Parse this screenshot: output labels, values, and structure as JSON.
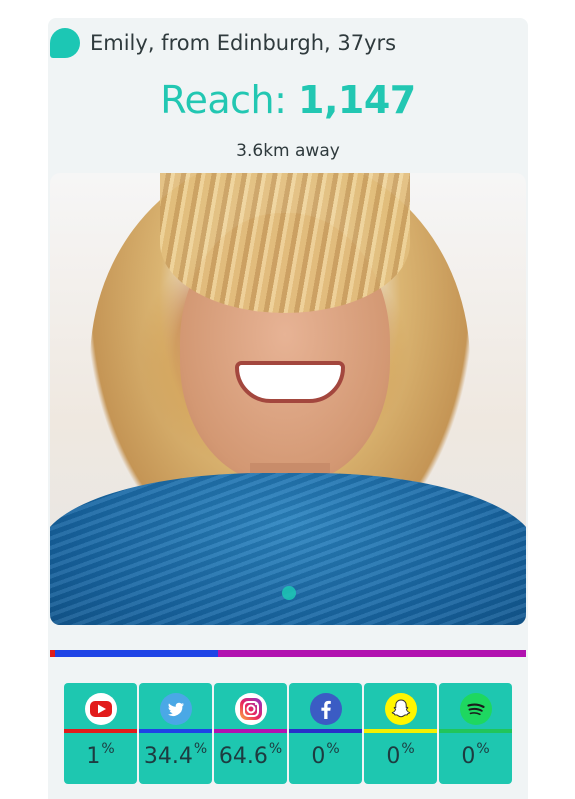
{
  "profile": {
    "name_line": "Emily, from Edinburgh, 37yrs",
    "reach_label": "Reach: ",
    "reach_value": "1,147",
    "distance": "3.6km away"
  },
  "distribution_bar": [
    {
      "platform": "YouTube",
      "percent": 1,
      "color": "#e01c1c"
    },
    {
      "platform": "Twitter",
      "percent": 34.4,
      "color": "#1e44e6"
    },
    {
      "platform": "Instagram",
      "percent": 64.6,
      "color": "#b112b0"
    }
  ],
  "platforms": [
    {
      "name": "youtube",
      "icon": "youtube-icon",
      "value": "1",
      "unit": "%",
      "color": "#e01c1c"
    },
    {
      "name": "twitter",
      "icon": "twitter-icon",
      "value": "34.4",
      "unit": "%",
      "color": "#1e44e6"
    },
    {
      "name": "instagram",
      "icon": "instagram-icon",
      "value": "64.6",
      "unit": "%",
      "color": "#b112b0"
    },
    {
      "name": "facebook",
      "icon": "facebook-icon",
      "value": "0",
      "unit": "%",
      "color": "#2830c8"
    },
    {
      "name": "snapchat",
      "icon": "snapchat-icon",
      "value": "0",
      "unit": "%",
      "color": "#f4f000"
    },
    {
      "name": "spotify",
      "icon": "spotify-icon",
      "value": "0",
      "unit": "%",
      "color": "#21c55b"
    }
  ],
  "colors": {
    "accent": "#1cc7b4",
    "tile_bg": "#1ec7b0",
    "card_bg": "#f0f4f5"
  }
}
